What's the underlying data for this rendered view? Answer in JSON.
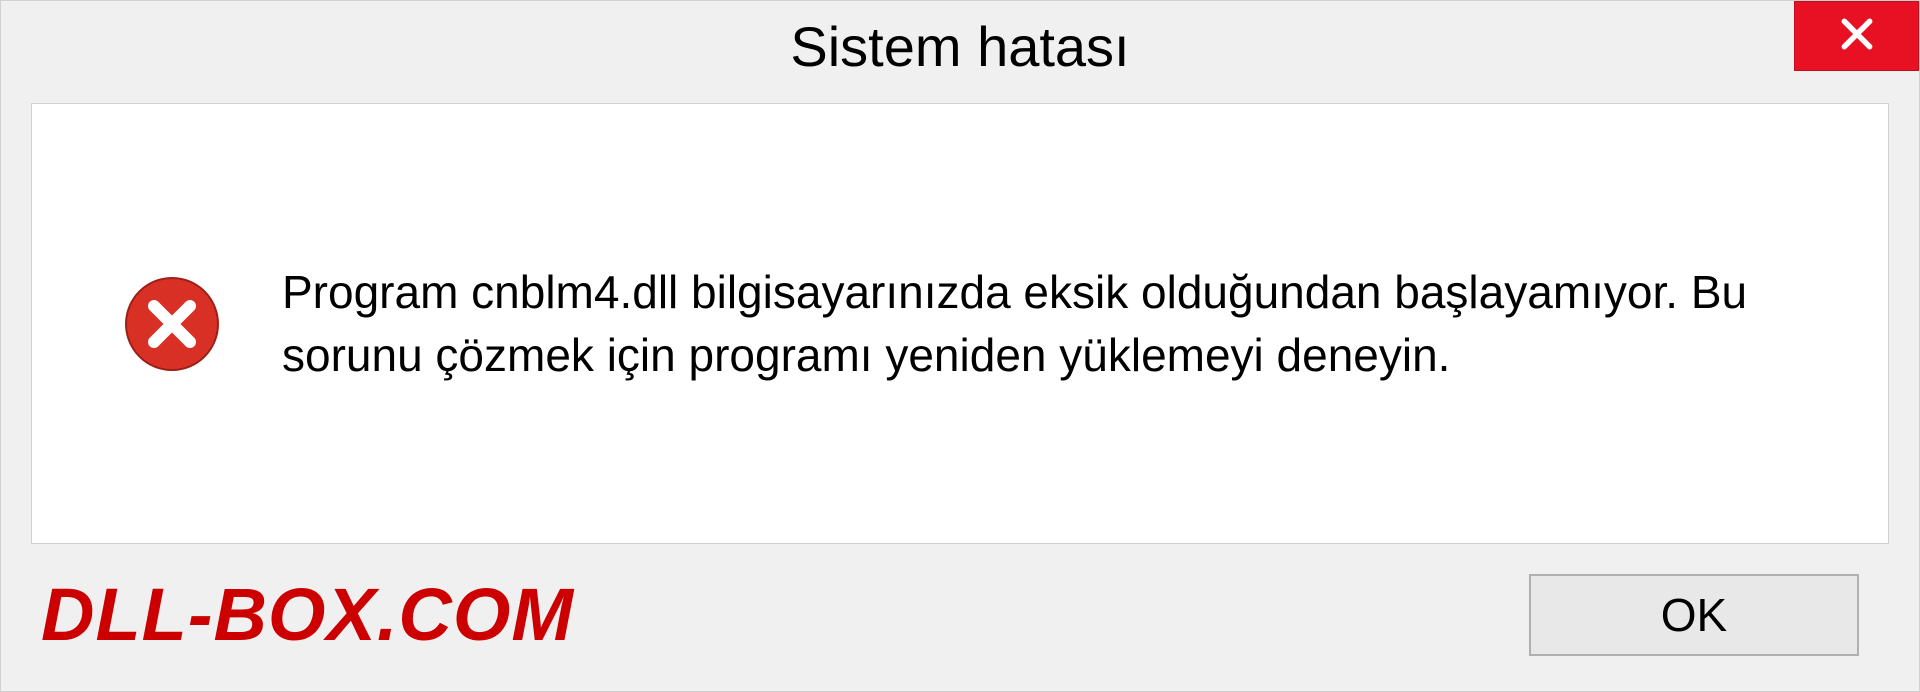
{
  "titlebar": {
    "title": "Sistem hatası"
  },
  "content": {
    "message": "Program cnblm4.dll bilgisayarınızda eksik olduğundan başlayamıyor. Bu sorunu çözmek için programı yeniden yüklemeyi deneyin."
  },
  "footer": {
    "branding": "DLL-BOX.COM",
    "ok_label": "OK"
  },
  "colors": {
    "close_bg": "#e81123",
    "error_icon": "#d93025",
    "brand": "#cc0000"
  }
}
